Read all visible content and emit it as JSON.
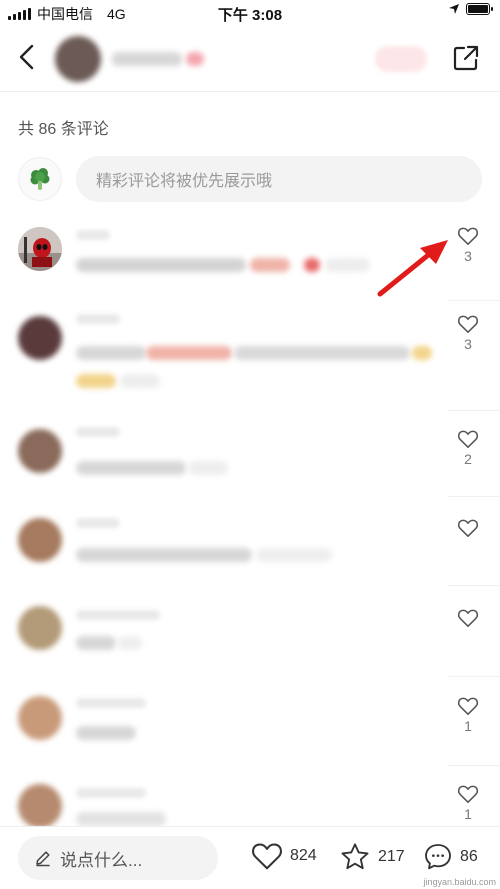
{
  "status_bar": {
    "carrier": "中国电信",
    "network": "4G",
    "time": "下午 3:08"
  },
  "comments_header": {
    "count_label": "共 86 条评论"
  },
  "comment_input": {
    "placeholder": "精彩评论将被优先展示哦"
  },
  "comments": [
    {
      "likes": "3"
    },
    {
      "likes": "3"
    },
    {
      "likes": "2"
    },
    {
      "likes": ""
    },
    {
      "likes": ""
    },
    {
      "likes": "1"
    },
    {
      "likes": "1"
    }
  ],
  "bottom_bar": {
    "say_placeholder": "说点什么...",
    "like_count": "824",
    "collect_count": "217",
    "comment_count": "86"
  },
  "watermark": "jingyan.baidu.com",
  "colors": {
    "accent_red": "#e8303a",
    "arrow_red": "#e11a1a"
  },
  "icons": [
    "back-icon",
    "share-icon",
    "broccoli-icon",
    "heart-icon",
    "star-icon",
    "comment-icon",
    "pencil-icon"
  ]
}
